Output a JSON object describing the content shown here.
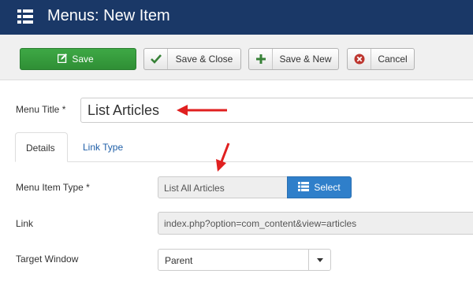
{
  "header": {
    "title": "Menus: New Item",
    "icon": "list-icon",
    "bg_color": "#1a3867"
  },
  "toolbar": {
    "save_label": "Save",
    "save_close_label": "Save & Close",
    "save_new_label": "Save & New",
    "cancel_label": "Cancel",
    "save_color": "#3ea845"
  },
  "form": {
    "menu_title_label": "Menu Title *",
    "menu_title_value": "List Articles",
    "tabs": [
      {
        "label": "Details",
        "active": true
      },
      {
        "label": "Link Type",
        "active": false
      }
    ],
    "menu_item_type_label": "Menu Item Type *",
    "menu_item_type_value": "List All Articles",
    "select_label": "Select",
    "link_label": "Link",
    "link_value": "index.php?option=com_content&view=articles",
    "target_window_label": "Target Window",
    "target_window_value": "Parent"
  },
  "annotations": {
    "arrow_color": "#e02020"
  }
}
